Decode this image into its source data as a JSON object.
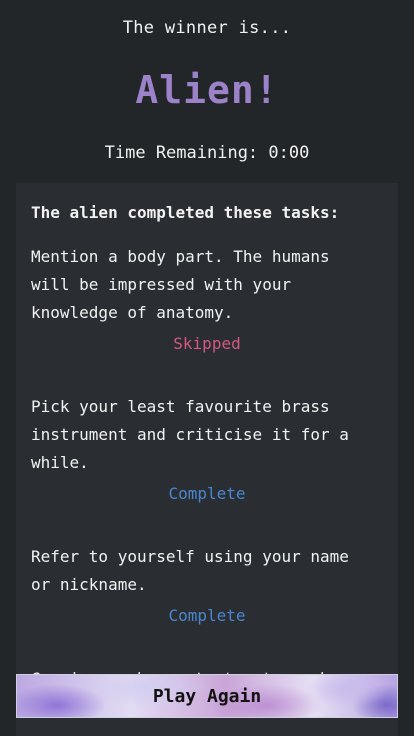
{
  "result": {
    "heading": "The winner is...",
    "winner": "Alien!",
    "time_remaining": "Time Remaining: 0:00"
  },
  "tasks_card": {
    "title": "The alien completed these tasks:",
    "tasks": [
      {
        "text": "Mention a body part. The humans\nwill be impressed with your\nknowledge of anatomy.",
        "status": "Skipped"
      },
      {
        "text": "Pick your least favourite brass\ninstrument and criticise it for a\nwhile.",
        "status": "Complete"
      },
      {
        "text": "Refer to yourself using your name\nor nickname.",
        "status": "Complete"
      },
      {
        "text": "Convince a human to trust you by",
        "status": ""
      }
    ]
  },
  "play_again_label": "Play Again",
  "colors": {
    "background": "#222629",
    "card": "#2a2e33",
    "winner_text": "#9b82c9",
    "skipped": "#d4587f",
    "complete": "#4a86cf"
  }
}
